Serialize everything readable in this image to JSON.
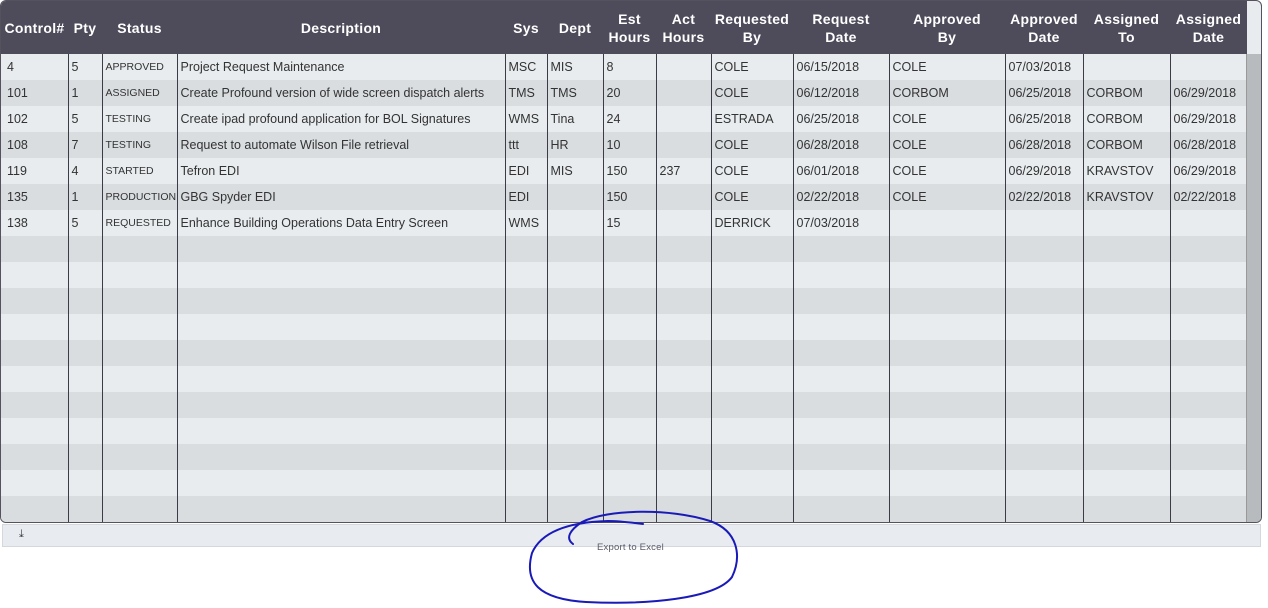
{
  "grid": {
    "columns": [
      {
        "key": "control",
        "label": "Control#"
      },
      {
        "key": "pty",
        "label": "Pty"
      },
      {
        "key": "status",
        "label": "Status"
      },
      {
        "key": "description",
        "label": "Description"
      },
      {
        "key": "sys",
        "label": "Sys"
      },
      {
        "key": "dept",
        "label": "Dept"
      },
      {
        "key": "est_hours",
        "label": "Est\nHours"
      },
      {
        "key": "act_hours",
        "label": "Act\nHours"
      },
      {
        "key": "requested_by",
        "label": "Requested\nBy"
      },
      {
        "key": "request_date",
        "label": "Request\nDate"
      },
      {
        "key": "approved_by",
        "label": "Approved\nBy"
      },
      {
        "key": "approved_date",
        "label": "Approved\nDate"
      },
      {
        "key": "assigned_to",
        "label": "Assigned\nTo"
      },
      {
        "key": "assigned_date",
        "label": "Assigned\nDate"
      }
    ],
    "rows": [
      [
        "4",
        "5",
        "APPROVED",
        "Project Request Maintenance",
        "MSC",
        "MIS",
        "8",
        "",
        "COLE",
        "06/15/2018",
        "COLE",
        "07/03/2018",
        "",
        ""
      ],
      [
        "101",
        "1",
        "ASSIGNED",
        "Create Profound version of wide screen dispatch alerts",
        "TMS",
        "TMS",
        "20",
        "",
        "COLE",
        "06/12/2018",
        "CORBOM",
        "06/25/2018",
        "CORBOM",
        "06/29/2018"
      ],
      [
        "102",
        "5",
        "TESTING",
        "Create ipad profound application for BOL Signatures",
        "WMS",
        "Tina",
        "24",
        "",
        "ESTRADA",
        "06/25/2018",
        "COLE",
        "06/25/2018",
        "CORBOM",
        "06/29/2018"
      ],
      [
        "108",
        "7",
        "TESTING",
        "Request to automate Wilson File retrieval",
        "ttt",
        "HR",
        "10",
        "",
        "COLE",
        "06/28/2018",
        "COLE",
        "06/28/2018",
        "CORBOM",
        "06/28/2018"
      ],
      [
        "119",
        "4",
        "STARTED",
        "Tefron EDI",
        "EDI",
        "MIS",
        "150",
        "237",
        "COLE",
        "06/01/2018",
        "COLE",
        "06/29/2018",
        "KRAVSTOV",
        "06/29/2018"
      ],
      [
        "135",
        "1",
        "PRODUCTION",
        "GBG Spyder EDI",
        "EDI",
        "",
        "150",
        "",
        "COLE",
        "02/22/2018",
        "COLE",
        "02/22/2018",
        "KRAVSTOV",
        "02/22/2018"
      ],
      [
        "138",
        "5",
        "REQUESTED",
        "Enhance Building Operations Data Entry Screen",
        "WMS",
        "",
        "15",
        "",
        "DERRICK",
        "07/03/2018",
        "",
        "",
        "",
        ""
      ]
    ],
    "empty_row_count": 11
  },
  "footer": {
    "download_icon": "download-icon",
    "export_label": "Export to Excel"
  },
  "colors": {
    "header_bg": "#4e4b5a",
    "row_odd": "#e8ecef",
    "row_even": "#d9dde0",
    "annotation": "#1a1ab8"
  }
}
